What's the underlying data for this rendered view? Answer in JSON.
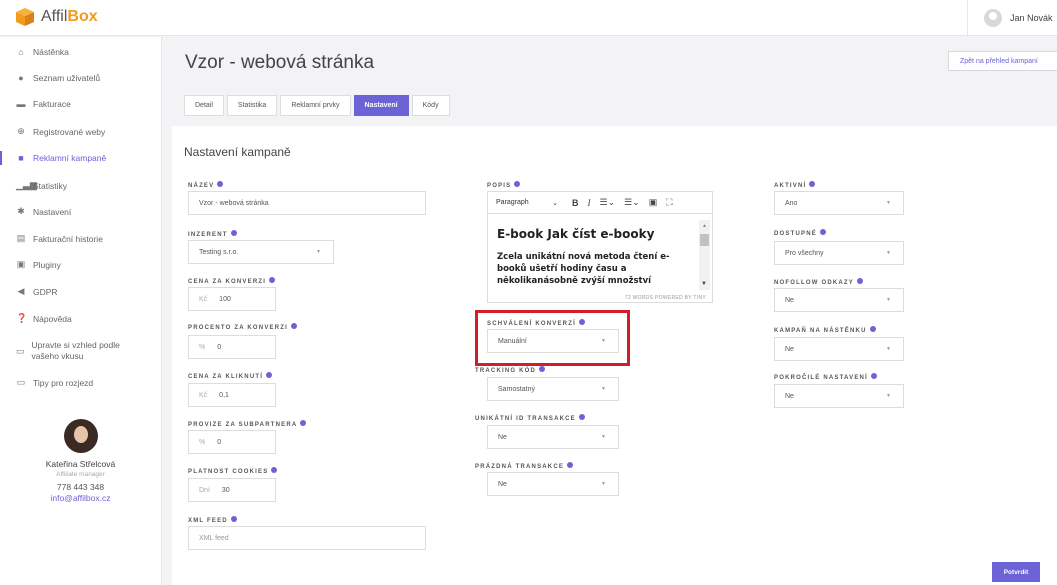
{
  "app": {
    "logo_prefix": "Affil",
    "logo_suffix": "Box"
  },
  "user": {
    "name": "Jan Novák"
  },
  "sidebar": {
    "items": [
      {
        "label": "Nástěnka",
        "icon": "home-icon"
      },
      {
        "label": "Seznam uživatelů",
        "icon": "users-icon"
      },
      {
        "label": "Fakturace",
        "icon": "invoice-icon"
      },
      {
        "label": "Registrované weby",
        "icon": "globe-icon"
      },
      {
        "label": "Reklamní kampaně",
        "icon": "campaign-icon"
      },
      {
        "label": "Statistiky",
        "icon": "stats-icon"
      },
      {
        "label": "Nastavení",
        "icon": "gear-icon"
      },
      {
        "label": "Fakturační historie",
        "icon": "history-icon"
      },
      {
        "label": "Pluginy",
        "icon": "plugin-icon"
      },
      {
        "label": "GDPR",
        "icon": "gdpr-icon"
      },
      {
        "label": "Nápověda",
        "icon": "help-icon"
      },
      {
        "label": "Upravte si vzhled podle vašeho vkusu",
        "icon": "theme-icon"
      },
      {
        "label": "Tipy pro rozjezd",
        "icon": "tips-icon"
      }
    ]
  },
  "contact": {
    "name": "Kateřina Střelcová",
    "role": "Affiliate manager",
    "phone": "778 443 348",
    "email": "info@affilbox.cz"
  },
  "page": {
    "title": "Vzor - webová stránka",
    "back_label": "Zpět na přehled kampaní",
    "tabs": [
      {
        "label": "Detail"
      },
      {
        "label": "Statistika"
      },
      {
        "label": "Reklamní prvky"
      },
      {
        "label": "Nastavení"
      },
      {
        "label": "Kódy"
      }
    ],
    "section_title": "Nastavení kampaně",
    "submit_label": "Potvrdit"
  },
  "form": {
    "nazev": {
      "label": "Název",
      "value": "Vzor - webová stránka"
    },
    "inzerent": {
      "label": "Inzerent",
      "value": "Testing s.r.o."
    },
    "cena_konverze": {
      "label": "Cena za konverzi",
      "prefix": "Kč",
      "value": "100"
    },
    "procento_konverze": {
      "label": "Procento za konverzi",
      "prefix": "%",
      "value": "0"
    },
    "cena_kliknuti": {
      "label": "Cena za kliknutí",
      "prefix": "Kč",
      "value": "0,1"
    },
    "provize_subpartnera": {
      "label": "Provize za subpartnera",
      "prefix": "%",
      "value": "0"
    },
    "platnost_cookies": {
      "label": "Platnost cookies",
      "prefix": "Dní",
      "value": "30"
    },
    "xml_feed": {
      "label": "XML feed",
      "placeholder": "XML feed"
    },
    "popis": {
      "label": "Popis",
      "format": "Paragraph",
      "heading": "E-book Jak číst e-booky",
      "text": "Zcela unikátní nová metoda čtení e-booků ušetří hodiny času a několikanásobně zvýší množství",
      "status": "72 WORDS POWERED BY TINY"
    },
    "schvaleni_konverzi": {
      "label": "Schválení konverzí",
      "value": "Manuální"
    },
    "tracking_kod": {
      "label": "Tracking kód",
      "value": "Samostatný"
    },
    "unikatni_id": {
      "label": "Unikátní ID transakce",
      "value": "Ne"
    },
    "prazdna_transakce": {
      "label": "Prázdná transakce",
      "value": "Ne"
    },
    "aktivni": {
      "label": "Aktivní",
      "value": "Ano"
    },
    "dostupne": {
      "label": "Dostupné",
      "value": "Pro všechny"
    },
    "nofollow": {
      "label": "Nofollow odkazy",
      "value": "Ne"
    },
    "kampan_nastenka": {
      "label": "Kampaň na nástěnku",
      "value": "Ne"
    },
    "pokrocile": {
      "label": "Pokročilé nastavení",
      "value": "Ne"
    }
  },
  "colors": {
    "accent": "#6c63d6",
    "brand": "#f39a1e",
    "highlight": "#d21e26"
  }
}
